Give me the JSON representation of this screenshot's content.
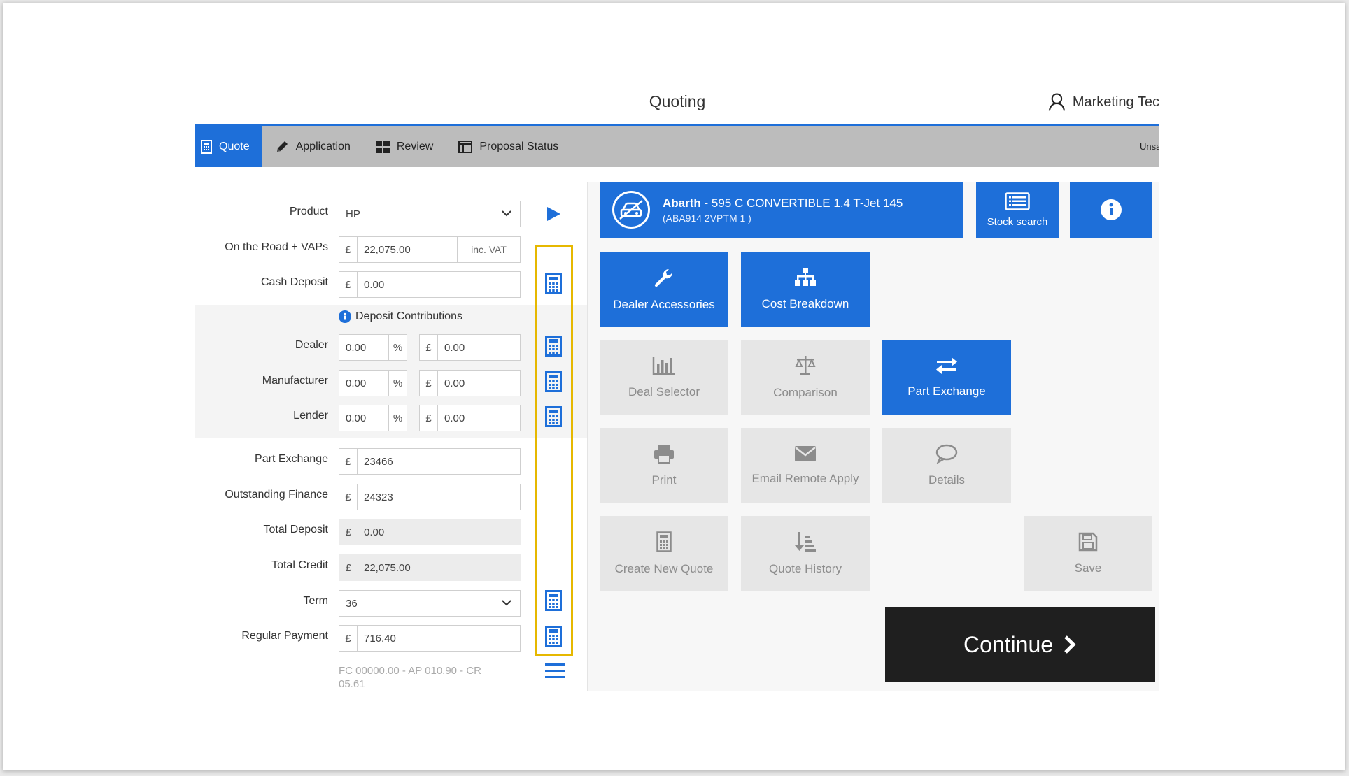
{
  "header": {
    "title": "Quoting",
    "user_name": "Marketing Tec"
  },
  "nav": {
    "tabs": [
      {
        "label": "Quote",
        "icon": "calculator-icon",
        "active": true
      },
      {
        "label": "Application",
        "icon": "pencil-icon",
        "active": false
      },
      {
        "label": "Review",
        "icon": "grid-icon",
        "active": false
      },
      {
        "label": "Proposal Status",
        "icon": "columns-icon",
        "active": false
      }
    ],
    "status_text": "Unsaved"
  },
  "form": {
    "product": {
      "label": "Product",
      "value": "HP"
    },
    "otr": {
      "label": "On the Road + VAPs",
      "currency": "£",
      "value": "22,075.00",
      "suffix": "inc. VAT"
    },
    "cash_deposit": {
      "label": "Cash Deposit",
      "currency": "£",
      "value": "0.00"
    },
    "contributions": {
      "title": "Deposit Contributions",
      "dealer": {
        "label": "Dealer",
        "pct": "0.00",
        "pct_sign": "%",
        "currency": "£",
        "amount": "0.00"
      },
      "manufacturer": {
        "label": "Manufacturer",
        "pct": "0.00",
        "pct_sign": "%",
        "currency": "£",
        "amount": "0.00"
      },
      "lender": {
        "label": "Lender",
        "pct": "0.00",
        "pct_sign": "%",
        "currency": "£",
        "amount": "0.00"
      }
    },
    "part_exchange": {
      "label": "Part Exchange",
      "currency": "£",
      "value": "23466"
    },
    "outstanding_finance": {
      "label": "Outstanding Finance",
      "currency": "£",
      "value": "24323"
    },
    "total_deposit": {
      "label": "Total Deposit",
      "currency": "£",
      "value": "0.00"
    },
    "total_credit": {
      "label": "Total Credit",
      "currency": "£",
      "value": "22,075.00"
    },
    "term": {
      "label": "Term",
      "value": "36"
    },
    "regular_payment": {
      "label": "Regular Payment",
      "currency": "£",
      "value": "716.40"
    },
    "footnote": "FC 00000.00 - AP 010.90 - CR 05.61"
  },
  "vehicle": {
    "make": "Abarth",
    "model": " - 595 C CONVERTIBLE 1.4 T-Jet 145",
    "code": "(ABA914  2VPTM  1  )"
  },
  "actions": {
    "stock_search": "Stock search",
    "dealer_accessories": "Dealer Accessories",
    "cost_breakdown": "Cost Breakdown",
    "deal_selector": "Deal Selector",
    "comparison": "Comparison",
    "part_exchange": "Part Exchange",
    "print": "Print",
    "email_remote_apply": "Email Remote Apply",
    "details": "Details",
    "create_new_quote": "Create New Quote",
    "quote_history": "Quote History",
    "save": "Save",
    "continue": "Continue"
  },
  "colors": {
    "accent": "#1e6fd9",
    "nav_bg": "#bcbcbc",
    "highlight": "#e6b800",
    "continue_bg": "#1f1f1f"
  }
}
